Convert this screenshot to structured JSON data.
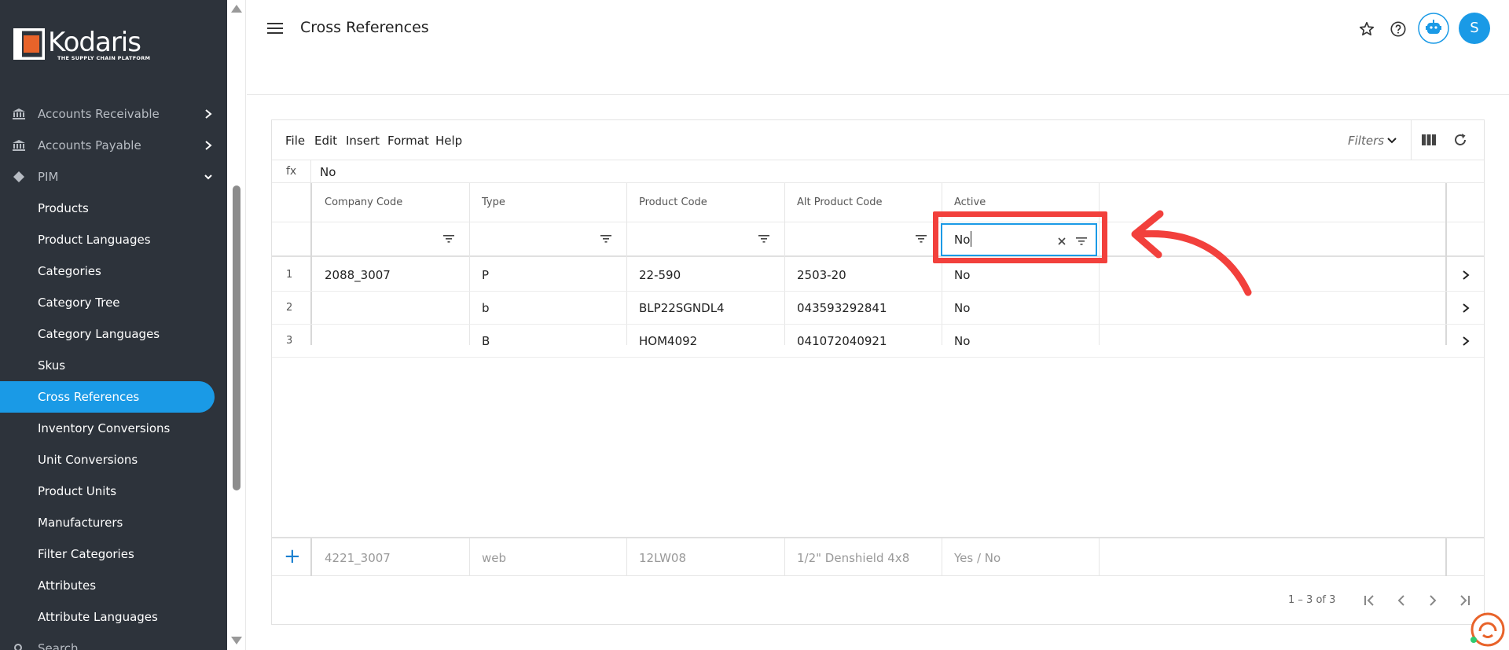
{
  "brand": {
    "name": "Kodaris",
    "tagline": "THE SUPPLY CHAIN PLATFORM",
    "accent": "#1a9ae6",
    "highlight": "#f2403c"
  },
  "sidebar": {
    "sections": [
      {
        "label": "Accounts Receivable",
        "icon": "bank-icon"
      },
      {
        "label": "Accounts Payable",
        "icon": "bank-icon"
      },
      {
        "label": "PIM",
        "icon": "tag-icon"
      }
    ],
    "items": [
      {
        "label": "Products"
      },
      {
        "label": "Product Languages"
      },
      {
        "label": "Categories"
      },
      {
        "label": "Category Tree"
      },
      {
        "label": "Category Languages"
      },
      {
        "label": "Skus"
      },
      {
        "label": "Cross References",
        "active": true
      },
      {
        "label": "Inventory Conversions"
      },
      {
        "label": "Unit Conversions"
      },
      {
        "label": "Product Units"
      },
      {
        "label": "Manufacturers"
      },
      {
        "label": "Filter Categories"
      },
      {
        "label": "Attributes"
      },
      {
        "label": "Attribute Languages"
      }
    ],
    "cut_item": {
      "label": "Search"
    }
  },
  "header": {
    "title": "Cross References",
    "avatar_initial": "S"
  },
  "toolbar": {
    "menus": [
      "File",
      "Edit",
      "Insert",
      "Format",
      "Help"
    ],
    "filters_label": "Filters"
  },
  "formula": {
    "fx_label": "fx",
    "value": "No"
  },
  "grid": {
    "columns": [
      "Company Code",
      "Type",
      "Product Code",
      "Alt Product Code",
      "Active"
    ],
    "active_filter_value": "No",
    "rows": [
      {
        "num": "1",
        "company_code": "2088_3007",
        "type": "P",
        "product_code": "22-590",
        "alt_product_code": "2503-20",
        "active": "No"
      },
      {
        "num": "2",
        "company_code": "",
        "type": "b",
        "product_code": "BLP22SGNDL4",
        "alt_product_code": "043593292841",
        "active": "No"
      },
      {
        "num": "3",
        "company_code": "",
        "type": "B",
        "product_code": "HOM4092",
        "alt_product_code": "041072040921",
        "active": "No"
      }
    ],
    "new_row_placeholders": {
      "company_code": "4221_3007",
      "type": "web",
      "product_code": "12LW08",
      "alt_product_code": "1/2\" Denshield 4x8",
      "active": "Yes / No"
    }
  },
  "pagination": {
    "range": "1 – 3 of 3"
  }
}
